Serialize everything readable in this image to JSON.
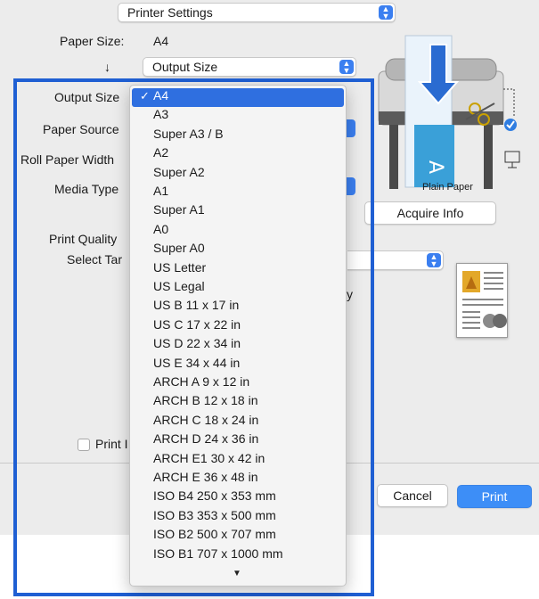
{
  "header": {
    "panel_select": "Printer Settings"
  },
  "settings": {
    "paper_size_label": "Paper Size:",
    "paper_size_value": "A4",
    "scale_arrow": "↓",
    "scale_target": "Output Size",
    "output_size_label": "Output Size",
    "paper_source_label": "Paper Source",
    "roll_paper_width_label": "Roll Paper Width",
    "media_type_label": "Media Type",
    "print_quality_label": "Print Quality",
    "select_target_label": "Select Tar",
    "partial_label_y": "y",
    "print_checkbox_label": "Print I"
  },
  "preview": {
    "media_label": "Plain Paper",
    "acquire_info_button": "Acquire Info"
  },
  "footer": {
    "cancel_button": "Cancel",
    "print_button": "Print"
  },
  "dropdown": {
    "selected_index": 0,
    "check_glyph": "✓",
    "scroll_down_glyph": "▼",
    "items": [
      "A4",
      "A3",
      "Super A3 / B",
      "A2",
      "Super A2",
      "A1",
      "Super A1",
      "A0",
      "Super A0",
      "US Letter",
      "US Legal",
      "US B 11 x 17 in",
      "US C 17 x 22 in",
      "US D 22 x 34 in",
      "US E 34 x 44 in",
      "ARCH A 9 x 12 in",
      "ARCH B 12 x 18 in",
      "ARCH C 18 x 24 in",
      "ARCH D 24 x 36 in",
      "ARCH E1 30 x 42 in",
      "ARCH E 36 x 48 in",
      "ISO B4 250 x 353 mm",
      "ISO B3 353 x 500 mm",
      "ISO B2 500 x 707 mm",
      "ISO B1 707 x 1000 mm"
    ]
  },
  "colors": {
    "accent": "#3b7ff0",
    "selection": "#2f6fe0",
    "frame": "#1f5fd3",
    "dialog_bg": "#ececec"
  }
}
